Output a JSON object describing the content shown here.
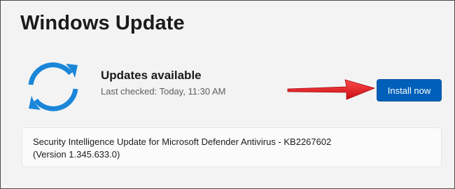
{
  "page": {
    "title": "Windows Update"
  },
  "status": {
    "icon": "sync-arrows-icon",
    "title": "Updates available",
    "last_checked": "Last checked: Today, 11:30 AM"
  },
  "actions": {
    "install_label": "Install now"
  },
  "updates": [
    {
      "line1": "Security Intelligence Update for Microsoft Defender Antivirus - KB2267602",
      "line2": "(Version 1.345.633.0)"
    }
  ],
  "colors": {
    "accent": "#005fb8",
    "icon_blue": "#1a86d9",
    "annotation_arrow": "#e8171c",
    "background": "#f3f3f3"
  }
}
